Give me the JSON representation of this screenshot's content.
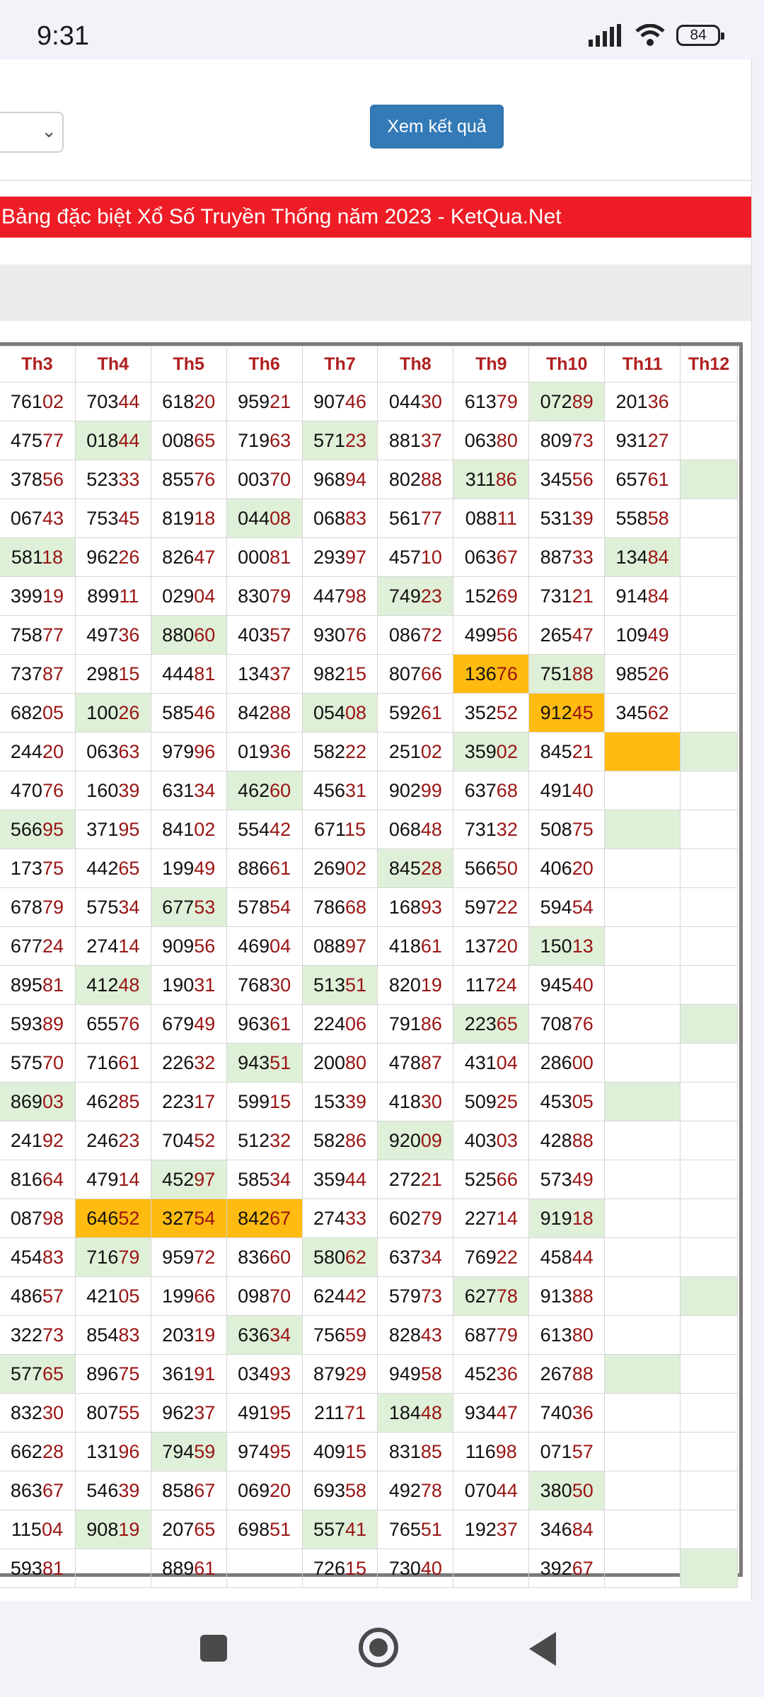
{
  "status_bar": {
    "time": "9:31",
    "battery": "84"
  },
  "form": {
    "submit_label": "Xem kết quả"
  },
  "banner": {
    "title": "Bảng đặc biệt Xổ Số Truyền Thống năm 2023 - KetQua.Net"
  },
  "colors": {
    "banner": "#ee1c25",
    "button": "#337ab7",
    "highlight_green": "#dff0d8",
    "highlight_orange": "#ffbb0f",
    "header_text": "#b01e1e",
    "last_digits": "#9a1414"
  },
  "table": {
    "columns": [
      "Th3",
      "Th4",
      "Th5",
      "Th6",
      "Th7",
      "Th8",
      "Th9",
      "Th10",
      "Th11",
      "Th12"
    ],
    "rows": [
      [
        {
          "v": "76102"
        },
        {
          "v": "70344"
        },
        {
          "v": "61820"
        },
        {
          "v": "95921"
        },
        {
          "v": "90746"
        },
        {
          "v": "04430"
        },
        {
          "v": "61379"
        },
        {
          "v": "07289",
          "bg": "g"
        },
        {
          "v": "20136"
        },
        {
          "v": ""
        }
      ],
      [
        {
          "v": "47577"
        },
        {
          "v": "01844",
          "bg": "g"
        },
        {
          "v": "00865"
        },
        {
          "v": "71963"
        },
        {
          "v": "57123",
          "bg": "g"
        },
        {
          "v": "88137"
        },
        {
          "v": "06380"
        },
        {
          "v": "80973"
        },
        {
          "v": "93127"
        },
        {
          "v": ""
        }
      ],
      [
        {
          "v": "37856"
        },
        {
          "v": "52333"
        },
        {
          "v": "85576"
        },
        {
          "v": "00370"
        },
        {
          "v": "96894"
        },
        {
          "v": "80288"
        },
        {
          "v": "31186",
          "bg": "g"
        },
        {
          "v": "34556"
        },
        {
          "v": "65761"
        },
        {
          "v": "",
          "bg": "g"
        }
      ],
      [
        {
          "v": "06743"
        },
        {
          "v": "75345"
        },
        {
          "v": "81918"
        },
        {
          "v": "04408",
          "bg": "g"
        },
        {
          "v": "06883"
        },
        {
          "v": "56177"
        },
        {
          "v": "08811"
        },
        {
          "v": "53139"
        },
        {
          "v": "55858"
        },
        {
          "v": ""
        }
      ],
      [
        {
          "v": "58118",
          "bg": "g"
        },
        {
          "v": "96226"
        },
        {
          "v": "82647"
        },
        {
          "v": "00081"
        },
        {
          "v": "29397"
        },
        {
          "v": "45710"
        },
        {
          "v": "06367"
        },
        {
          "v": "88733"
        },
        {
          "v": "13484",
          "bg": "g"
        },
        {
          "v": ""
        }
      ],
      [
        {
          "v": "39919"
        },
        {
          "v": "89911"
        },
        {
          "v": "02904"
        },
        {
          "v": "83079"
        },
        {
          "v": "44798"
        },
        {
          "v": "74923",
          "bg": "g"
        },
        {
          "v": "15269"
        },
        {
          "v": "73121"
        },
        {
          "v": "91484"
        },
        {
          "v": ""
        }
      ],
      [
        {
          "v": "75877"
        },
        {
          "v": "49736"
        },
        {
          "v": "88060",
          "bg": "g"
        },
        {
          "v": "40357"
        },
        {
          "v": "93076"
        },
        {
          "v": "08672"
        },
        {
          "v": "49956"
        },
        {
          "v": "26547"
        },
        {
          "v": "10949"
        },
        {
          "v": ""
        }
      ],
      [
        {
          "v": "73787"
        },
        {
          "v": "29815"
        },
        {
          "v": "44481"
        },
        {
          "v": "13437"
        },
        {
          "v": "98215"
        },
        {
          "v": "80766"
        },
        {
          "v": "13676",
          "bg": "o"
        },
        {
          "v": "75188",
          "bg": "g"
        },
        {
          "v": "98526"
        },
        {
          "v": ""
        }
      ],
      [
        {
          "v": "68205"
        },
        {
          "v": "10026",
          "bg": "g"
        },
        {
          "v": "58546"
        },
        {
          "v": "84288"
        },
        {
          "v": "05408",
          "bg": "g"
        },
        {
          "v": "59261"
        },
        {
          "v": "35252"
        },
        {
          "v": "91245",
          "bg": "o"
        },
        {
          "v": "34562"
        },
        {
          "v": ""
        }
      ],
      [
        {
          "v": "24420"
        },
        {
          "v": "06363"
        },
        {
          "v": "97996"
        },
        {
          "v": "01936"
        },
        {
          "v": "58222"
        },
        {
          "v": "25102"
        },
        {
          "v": "35902",
          "bg": "g"
        },
        {
          "v": "84521"
        },
        {
          "v": "",
          "bg": "o"
        },
        {
          "v": "",
          "bg": "g"
        }
      ],
      [
        {
          "v": "47076"
        },
        {
          "v": "16039"
        },
        {
          "v": "63134"
        },
        {
          "v": "46260",
          "bg": "g"
        },
        {
          "v": "45631"
        },
        {
          "v": "90299"
        },
        {
          "v": "63768"
        },
        {
          "v": "49140"
        },
        {
          "v": ""
        },
        {
          "v": ""
        }
      ],
      [
        {
          "v": "56695",
          "bg": "g"
        },
        {
          "v": "37195"
        },
        {
          "v": "84102"
        },
        {
          "v": "55442"
        },
        {
          "v": "67115"
        },
        {
          "v": "06848"
        },
        {
          "v": "73132"
        },
        {
          "v": "50875"
        },
        {
          "v": "",
          "bg": "g"
        },
        {
          "v": ""
        }
      ],
      [
        {
          "v": "17375"
        },
        {
          "v": "44265"
        },
        {
          "v": "19949"
        },
        {
          "v": "88661"
        },
        {
          "v": "26902"
        },
        {
          "v": "84528",
          "bg": "g"
        },
        {
          "v": "56650"
        },
        {
          "v": "40620"
        },
        {
          "v": ""
        },
        {
          "v": ""
        }
      ],
      [
        {
          "v": "67879"
        },
        {
          "v": "57534"
        },
        {
          "v": "67753",
          "bg": "g"
        },
        {
          "v": "57854"
        },
        {
          "v": "78668"
        },
        {
          "v": "16893"
        },
        {
          "v": "59722"
        },
        {
          "v": "59454"
        },
        {
          "v": ""
        },
        {
          "v": ""
        }
      ],
      [
        {
          "v": "67724"
        },
        {
          "v": "27414"
        },
        {
          "v": "90956"
        },
        {
          "v": "46904"
        },
        {
          "v": "08897"
        },
        {
          "v": "41861"
        },
        {
          "v": "13720"
        },
        {
          "v": "15013",
          "bg": "g"
        },
        {
          "v": ""
        },
        {
          "v": ""
        }
      ],
      [
        {
          "v": "89581"
        },
        {
          "v": "41248",
          "bg": "g"
        },
        {
          "v": "19031"
        },
        {
          "v": "76830"
        },
        {
          "v": "51351",
          "bg": "g"
        },
        {
          "v": "82019"
        },
        {
          "v": "11724"
        },
        {
          "v": "94540"
        },
        {
          "v": ""
        },
        {
          "v": ""
        }
      ],
      [
        {
          "v": "59389"
        },
        {
          "v": "65576"
        },
        {
          "v": "67949"
        },
        {
          "v": "96361"
        },
        {
          "v": "22406"
        },
        {
          "v": "79186"
        },
        {
          "v": "22365",
          "bg": "g"
        },
        {
          "v": "70876"
        },
        {
          "v": ""
        },
        {
          "v": "",
          "bg": "g"
        }
      ],
      [
        {
          "v": "57570"
        },
        {
          "v": "71661"
        },
        {
          "v": "22632"
        },
        {
          "v": "94351",
          "bg": "g"
        },
        {
          "v": "20080"
        },
        {
          "v": "47887"
        },
        {
          "v": "43104"
        },
        {
          "v": "28600"
        },
        {
          "v": ""
        },
        {
          "v": ""
        }
      ],
      [
        {
          "v": "86903",
          "bg": "g"
        },
        {
          "v": "46285"
        },
        {
          "v": "22317"
        },
        {
          "v": "59915"
        },
        {
          "v": "15339"
        },
        {
          "v": "41830"
        },
        {
          "v": "50925"
        },
        {
          "v": "45305"
        },
        {
          "v": "",
          "bg": "g"
        },
        {
          "v": ""
        }
      ],
      [
        {
          "v": "24192"
        },
        {
          "v": "24623"
        },
        {
          "v": "70452"
        },
        {
          "v": "51232"
        },
        {
          "v": "58286"
        },
        {
          "v": "92009",
          "bg": "g"
        },
        {
          "v": "40303"
        },
        {
          "v": "42888"
        },
        {
          "v": ""
        },
        {
          "v": ""
        }
      ],
      [
        {
          "v": "81664"
        },
        {
          "v": "47914"
        },
        {
          "v": "45297",
          "bg": "g"
        },
        {
          "v": "58534"
        },
        {
          "v": "35944"
        },
        {
          "v": "27221"
        },
        {
          "v": "52566"
        },
        {
          "v": "57349"
        },
        {
          "v": ""
        },
        {
          "v": ""
        }
      ],
      [
        {
          "v": "08798"
        },
        {
          "v": "64652",
          "bg": "o"
        },
        {
          "v": "32754",
          "bg": "o"
        },
        {
          "v": "84267",
          "bg": "o"
        },
        {
          "v": "27433"
        },
        {
          "v": "60279"
        },
        {
          "v": "22714"
        },
        {
          "v": "91918",
          "bg": "g"
        },
        {
          "v": ""
        },
        {
          "v": ""
        }
      ],
      [
        {
          "v": "45483"
        },
        {
          "v": "71679",
          "bg": "g"
        },
        {
          "v": "95972"
        },
        {
          "v": "83660"
        },
        {
          "v": "58062",
          "bg": "g"
        },
        {
          "v": "63734"
        },
        {
          "v": "76922"
        },
        {
          "v": "45844"
        },
        {
          "v": ""
        },
        {
          "v": ""
        }
      ],
      [
        {
          "v": "48657"
        },
        {
          "v": "42105"
        },
        {
          "v": "19966"
        },
        {
          "v": "09870"
        },
        {
          "v": "62442"
        },
        {
          "v": "57973"
        },
        {
          "v": "62778",
          "bg": "g"
        },
        {
          "v": "91388"
        },
        {
          "v": ""
        },
        {
          "v": "",
          "bg": "g"
        }
      ],
      [
        {
          "v": "32273"
        },
        {
          "v": "85483"
        },
        {
          "v": "20319"
        },
        {
          "v": "63634",
          "bg": "g"
        },
        {
          "v": "75659"
        },
        {
          "v": "82843"
        },
        {
          "v": "68779"
        },
        {
          "v": "61380"
        },
        {
          "v": ""
        },
        {
          "v": ""
        }
      ],
      [
        {
          "v": "57765",
          "bg": "g"
        },
        {
          "v": "89675"
        },
        {
          "v": "36191"
        },
        {
          "v": "03493"
        },
        {
          "v": "87929"
        },
        {
          "v": "94958"
        },
        {
          "v": "45236"
        },
        {
          "v": "26788"
        },
        {
          "v": "",
          "bg": "g"
        },
        {
          "v": ""
        }
      ],
      [
        {
          "v": "83230"
        },
        {
          "v": "80755"
        },
        {
          "v": "96237"
        },
        {
          "v": "49195"
        },
        {
          "v": "21171"
        },
        {
          "v": "18448",
          "bg": "g"
        },
        {
          "v": "93447"
        },
        {
          "v": "74036"
        },
        {
          "v": ""
        },
        {
          "v": ""
        }
      ],
      [
        {
          "v": "66228"
        },
        {
          "v": "13196"
        },
        {
          "v": "79459",
          "bg": "g"
        },
        {
          "v": "97495"
        },
        {
          "v": "40915"
        },
        {
          "v": "83185"
        },
        {
          "v": "11698"
        },
        {
          "v": "07157"
        },
        {
          "v": ""
        },
        {
          "v": ""
        }
      ],
      [
        {
          "v": "86367"
        },
        {
          "v": "54639"
        },
        {
          "v": "85867"
        },
        {
          "v": "06920"
        },
        {
          "v": "69358"
        },
        {
          "v": "49278"
        },
        {
          "v": "07044"
        },
        {
          "v": "38050",
          "bg": "g"
        },
        {
          "v": ""
        },
        {
          "v": ""
        }
      ],
      [
        {
          "v": "11504"
        },
        {
          "v": "90819",
          "bg": "g"
        },
        {
          "v": "20765"
        },
        {
          "v": "69851"
        },
        {
          "v": "55741",
          "bg": "g"
        },
        {
          "v": "76551"
        },
        {
          "v": "19237"
        },
        {
          "v": "34684"
        },
        {
          "v": ""
        },
        {
          "v": ""
        }
      ],
      [
        {
          "v": "59381"
        },
        {
          "v": ""
        },
        {
          "v": "88961"
        },
        {
          "v": ""
        },
        {
          "v": "72615"
        },
        {
          "v": "73040"
        },
        {
          "v": ""
        },
        {
          "v": "39267"
        },
        {
          "v": ""
        },
        {
          "v": "",
          "bg": "g"
        }
      ]
    ]
  }
}
